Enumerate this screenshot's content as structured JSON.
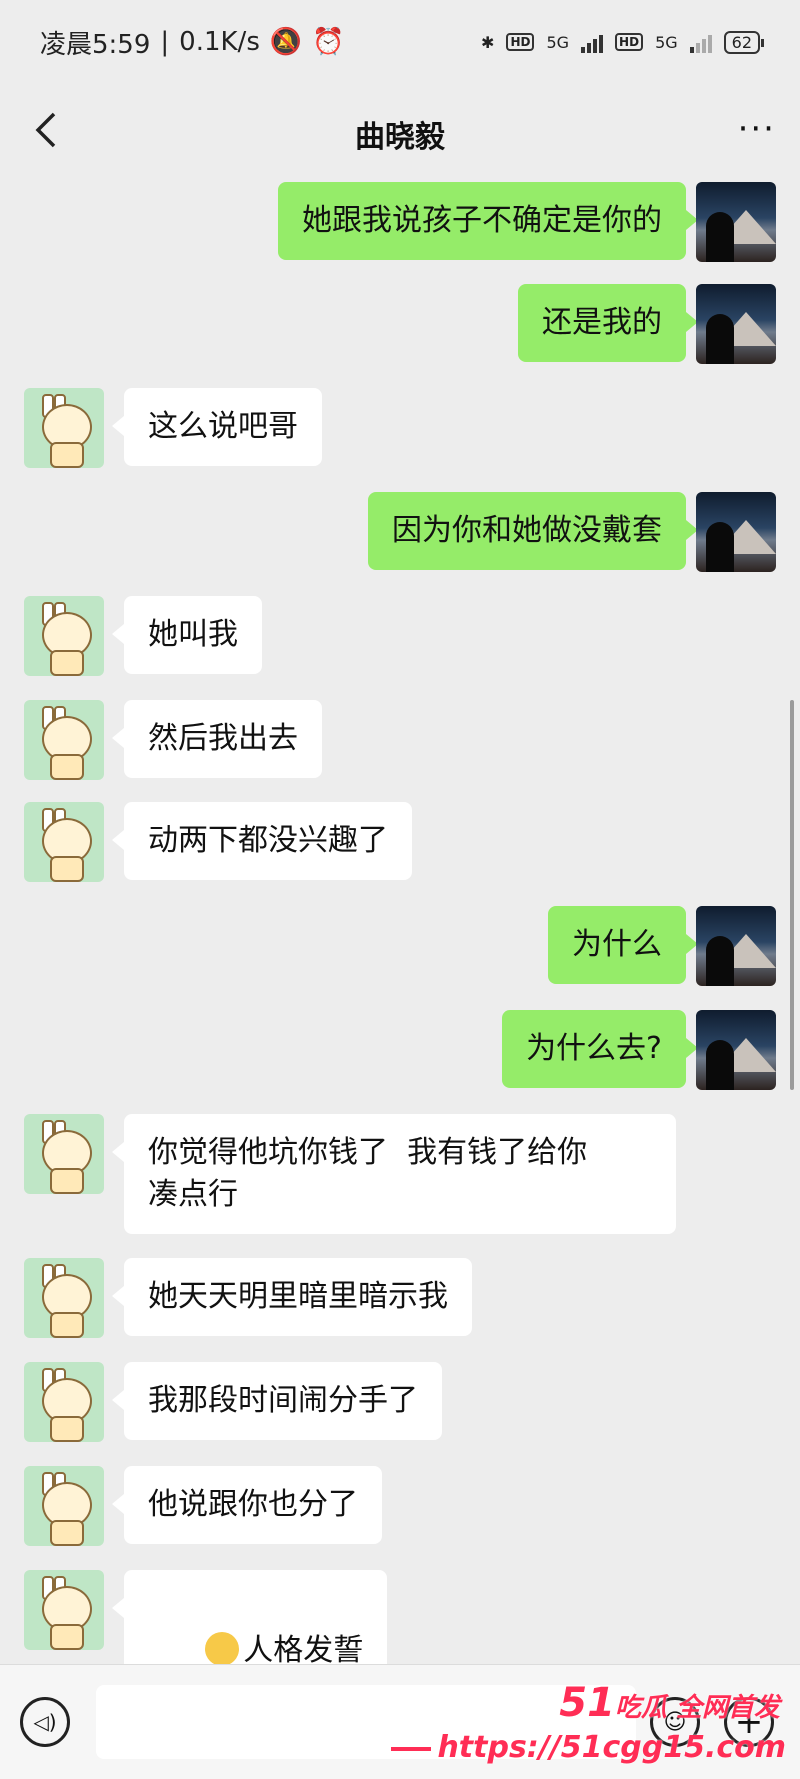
{
  "status_bar": {
    "time": "凌晨5:59",
    "speed": "0.1K/s",
    "hd1": "HD",
    "net1": "5G",
    "hd2": "HD",
    "net2": "5G",
    "battery": "62"
  },
  "header": {
    "title": "曲晓毅",
    "more": "···"
  },
  "messages": [
    {
      "side": "self",
      "text": "她跟我说孩子不确定是你的"
    },
    {
      "side": "self",
      "text": "还是我的"
    },
    {
      "side": "other",
      "text": "这么说吧哥"
    },
    {
      "side": "self",
      "text": "因为你和她做没戴套"
    },
    {
      "side": "other",
      "text": "她叫我"
    },
    {
      "side": "other",
      "text": "然后我出去"
    },
    {
      "side": "other",
      "text": "动两下都没兴趣了"
    },
    {
      "side": "self",
      "text": "为什么"
    },
    {
      "side": "self",
      "text": "为什么去?"
    },
    {
      "side": "other",
      "text": "你觉得他坑你钱了  我有钱了给你\n凑点行"
    },
    {
      "side": "other",
      "text": "她天天明里暗里暗示我"
    },
    {
      "side": "other",
      "text": "我那段时间闹分手了"
    },
    {
      "side": "other",
      "text": "他说跟你也分了"
    },
    {
      "side": "other",
      "text": "人格发誓",
      "emoji": "relieved-face"
    }
  ],
  "watermark": {
    "line1_num": "51",
    "line1_text": "吃瓜 全网首发",
    "line2": "https://51cgg15.com"
  },
  "colors": {
    "self_bubble": "#95ec69",
    "other_bubble": "#ffffff",
    "background": "#ededed",
    "watermark": "#ff2d55"
  }
}
